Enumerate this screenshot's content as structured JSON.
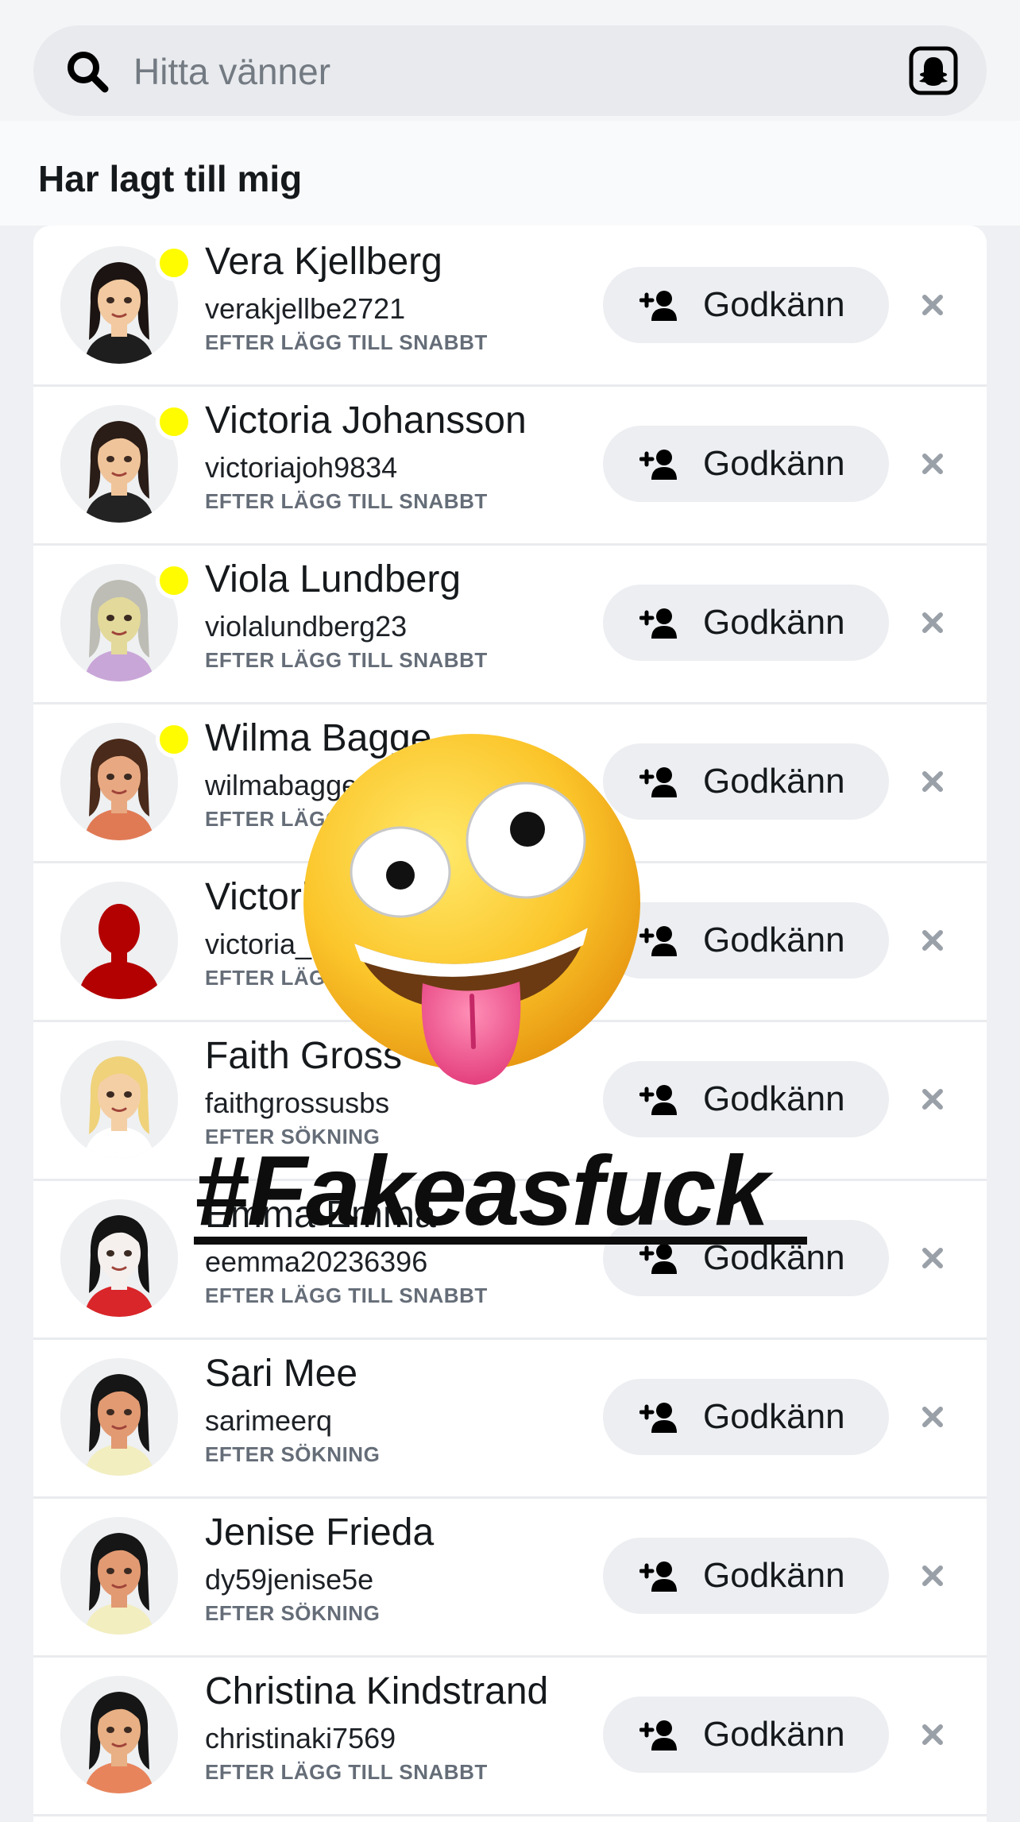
{
  "search": {
    "placeholder": "Hitta vänner",
    "icon": "search-icon",
    "right_icon": "bitmoji-ghost-icon"
  },
  "section": {
    "title": "Har lagt till mig"
  },
  "accept_label": "Godkänn",
  "accept_icon": "add-friend-icon",
  "dismiss_icon": "close-icon",
  "online_dot_color": "#fffc00",
  "rows": [
    {
      "name": "Vera Kjellberg",
      "username": "verakjellbe2721",
      "source": "EFTER LÄGG TILL SNABBT",
      "online": true,
      "hair": "#1c1412",
      "skin": "#f2c9a0",
      "shirt": "#1e1e1e"
    },
    {
      "name": "Victoria Johansson",
      "username": "victoriajoh9834",
      "source": "EFTER LÄGG TILL SNABBT",
      "online": true,
      "hair": "#2a1c16",
      "skin": "#f0c49a",
      "shirt": "#232323"
    },
    {
      "name": "Viola Lundberg",
      "username": "violalundberg23",
      "source": "EFTER LÄGG TILL SNABBT",
      "online": true,
      "hair": "#bdbdb5",
      "skin": "#e3d99b",
      "shirt": "#c9a6d8"
    },
    {
      "name": "Wilma Bagge",
      "username": "wilmabagge",
      "source": "EFTER LÄGG TILL SNABBT",
      "online": true,
      "hair": "#4a2a1a",
      "skin": "#e8a982",
      "shirt": "#e07a55"
    },
    {
      "name": "Victoria",
      "username": "victoria_",
      "source": "EFTER LÄGG TILL SNABBT",
      "online": false,
      "silhouette": true
    },
    {
      "name": "Faith Gross",
      "username": "faithgrossusbs",
      "source": "EFTER SÖKNING",
      "online": false,
      "hair": "#efd27a",
      "skin": "#f4cfa6",
      "shirt": "#ffffff"
    },
    {
      "name": "Emma Emma",
      "username": "eemma20236396",
      "source": "EFTER LÄGG TILL SNABBT",
      "online": false,
      "hair": "#141414",
      "skin": "#f5f0ee",
      "shirt": "#d9262a"
    },
    {
      "name": "Sari Mee",
      "username": "sarimeerq",
      "source": "EFTER SÖKNING",
      "online": false,
      "hair": "#161616",
      "skin": "#e29a72",
      "shirt": "#f2eec0"
    },
    {
      "name": "Jenise Frieda",
      "username": "dy59jenise5e",
      "source": "EFTER SÖKNING",
      "online": false,
      "hair": "#161616",
      "skin": "#e29a72",
      "shirt": "#f2eec0"
    },
    {
      "name": "Christina Kindstrand",
      "username": "christinaki7569",
      "source": "EFTER LÄGG TILL SNABBT",
      "online": false,
      "hair": "#161616",
      "skin": "#e8b084",
      "shirt": "#e8845c"
    }
  ],
  "overlay": {
    "emoji": "zany-face-emoji",
    "text": "#Fakeasfuck"
  }
}
